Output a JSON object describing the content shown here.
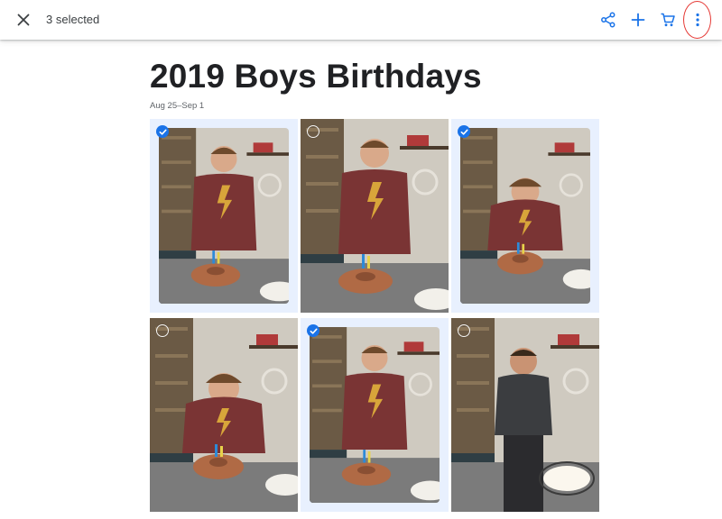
{
  "toolbar": {
    "selected_text": "3 selected",
    "icons": [
      "close-icon",
      "share-icon",
      "add-icon",
      "cart-icon",
      "more-vert-icon"
    ],
    "accent_color": "#1a73e8",
    "highlight_color": "#e53935"
  },
  "album": {
    "title": "2019 Boys Birthdays",
    "dates": "Aug 25–Sep 1"
  },
  "photos": [
    {
      "selected": true,
      "scene": "standing-smiling"
    },
    {
      "selected": false,
      "scene": "standing-laughing"
    },
    {
      "selected": true,
      "scene": "blowing-candles"
    },
    {
      "selected": false,
      "scene": "blowing-candles"
    },
    {
      "selected": true,
      "scene": "standing-laughing"
    },
    {
      "selected": false,
      "scene": "standing-dark-shirt"
    }
  ],
  "colors": {
    "selected_tile_bg": "#e8f0fe",
    "shirt": "#7a3434",
    "logo": "#d8a53a"
  }
}
